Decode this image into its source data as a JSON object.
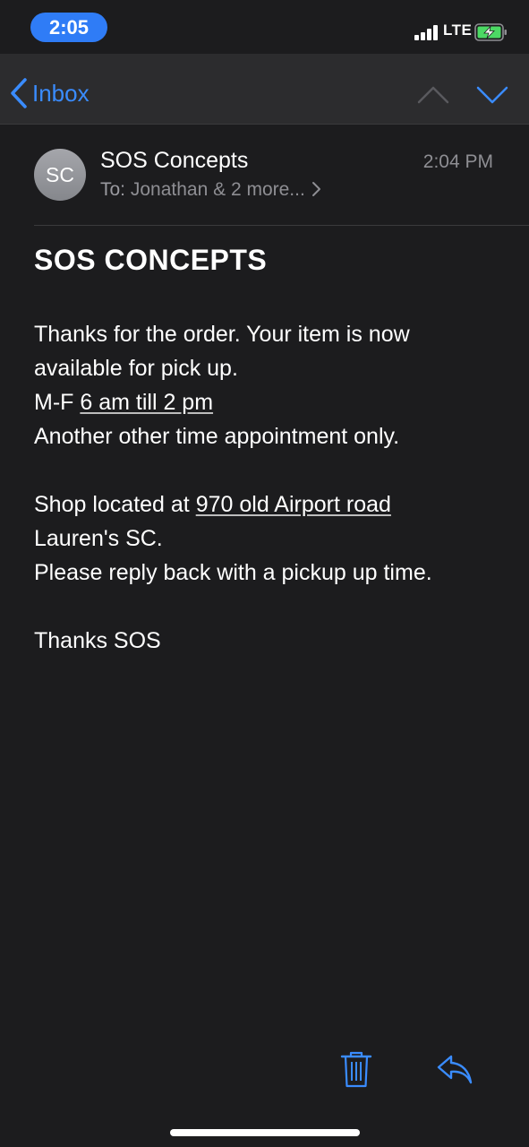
{
  "status_bar": {
    "time": "2:05",
    "network": "LTE"
  },
  "nav": {
    "back_label": "Inbox"
  },
  "message": {
    "avatar_initials": "SC",
    "sender": "SOS Concepts",
    "time": "2:04 PM",
    "to_label": "To:",
    "recipients": "Jonathan & 2 more...",
    "title": "SOS CONCEPTS",
    "line1": "Thanks for the order. Your item is now available for pick up.",
    "line2_prefix": "M-F ",
    "line2_link": "6 am till 2 pm",
    "line3": "Another other time appointment only.",
    "line4_prefix": "Shop located at ",
    "line4_link": "970 old Airport road",
    "line5": "Lauren's SC.",
    "line6": "Please reply back with a pickup up time.",
    "signoff": "Thanks SOS"
  },
  "colors": {
    "accent": "#3a8cff",
    "background": "#1c1c1e",
    "nav_background": "#2c2c2e",
    "secondary_text": "#8e8e93"
  }
}
